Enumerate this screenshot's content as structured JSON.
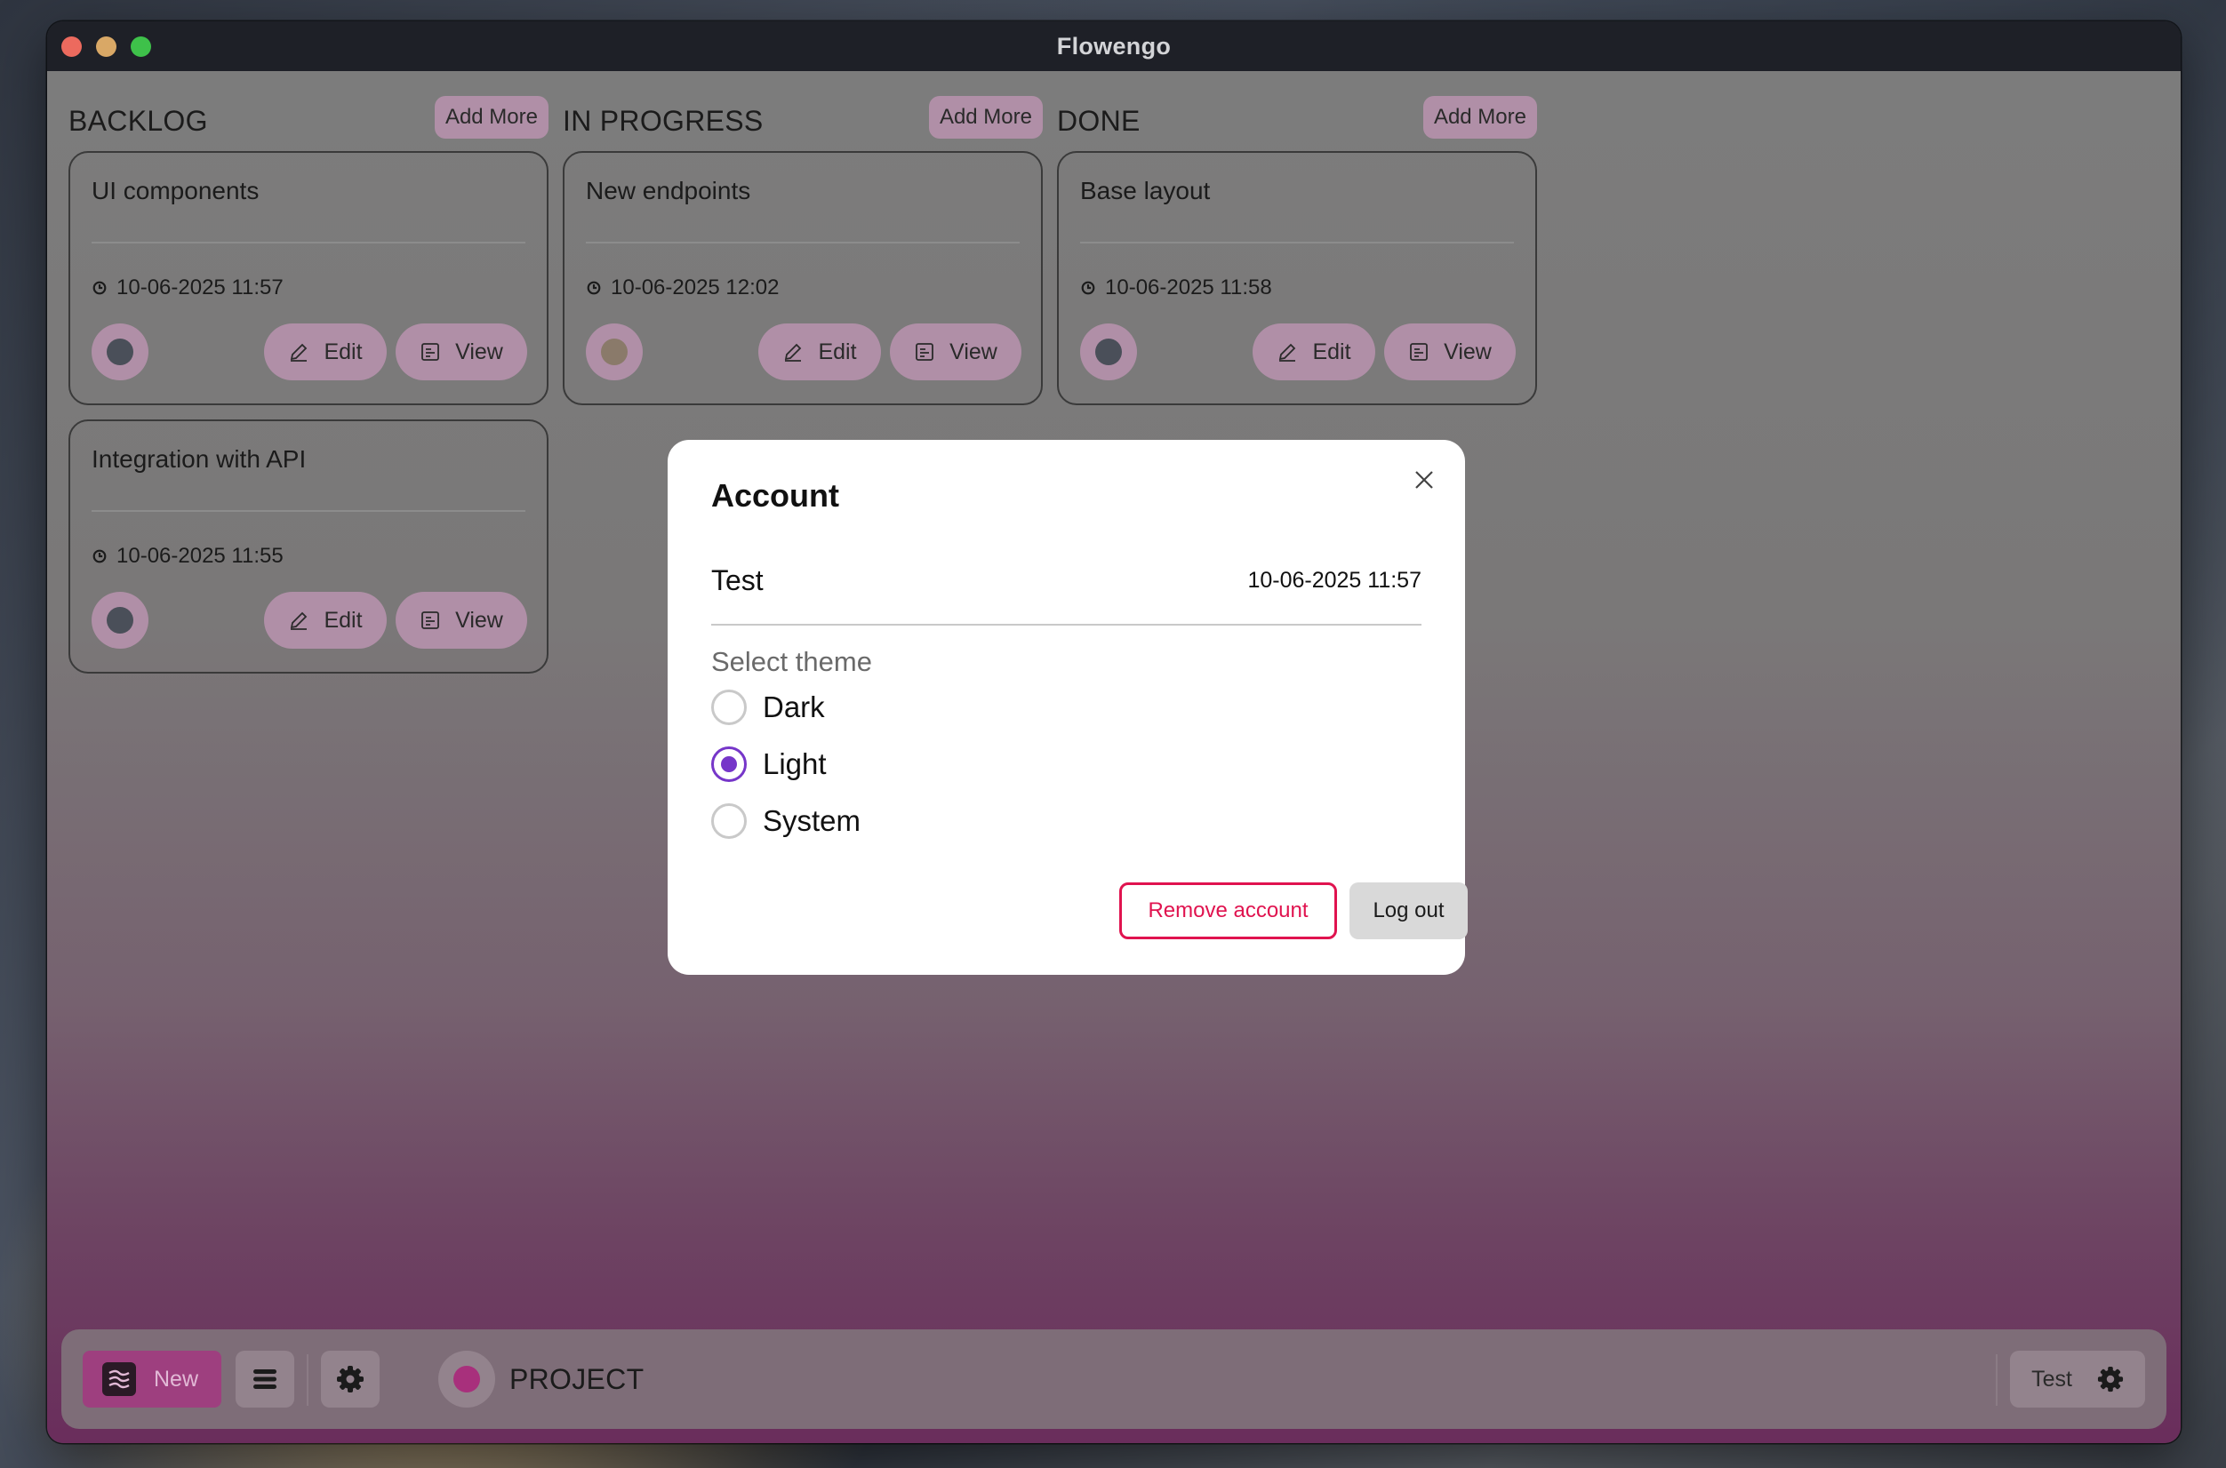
{
  "window": {
    "title": "Flowengo"
  },
  "columns": [
    {
      "title": "BACKLOG",
      "add_label": "Add More",
      "cards": [
        {
          "title": "UI components",
          "date": "10-06-2025 11:57",
          "status_color": "#4a4f59",
          "edit_label": "Edit",
          "view_label": "View"
        },
        {
          "title": "Integration with API",
          "date": "10-06-2025 11:55",
          "status_color": "#4a4f59",
          "edit_label": "Edit",
          "view_label": "View"
        }
      ]
    },
    {
      "title": "IN PROGRESS",
      "add_label": "Add More",
      "cards": [
        {
          "title": "New endpoints",
          "date": "10-06-2025 12:02",
          "status_color": "#8a7a6a",
          "edit_label": "Edit",
          "view_label": "View"
        }
      ]
    },
    {
      "title": "DONE",
      "add_label": "Add More",
      "cards": [
        {
          "title": "Base layout",
          "date": "10-06-2025 11:58",
          "status_color": "#4a4f59",
          "edit_label": "Edit",
          "view_label": "View"
        }
      ]
    }
  ],
  "bottombar": {
    "new_label": "New",
    "project_label": "PROJECT",
    "user_label": "Test"
  },
  "modal": {
    "title": "Account",
    "account_name": "Test",
    "account_date": "10-06-2025 11:57",
    "theme_label": "Select theme",
    "themes": [
      {
        "label": "Dark",
        "selected": false
      },
      {
        "label": "Light",
        "selected": true
      },
      {
        "label": "System",
        "selected": false
      }
    ],
    "remove_label": "Remove account",
    "logout_label": "Log out"
  },
  "colors": {
    "accent": "#7636c9",
    "danger": "#e0134f",
    "brand": "#9e3f7f",
    "project_dot": "#a8307c"
  }
}
